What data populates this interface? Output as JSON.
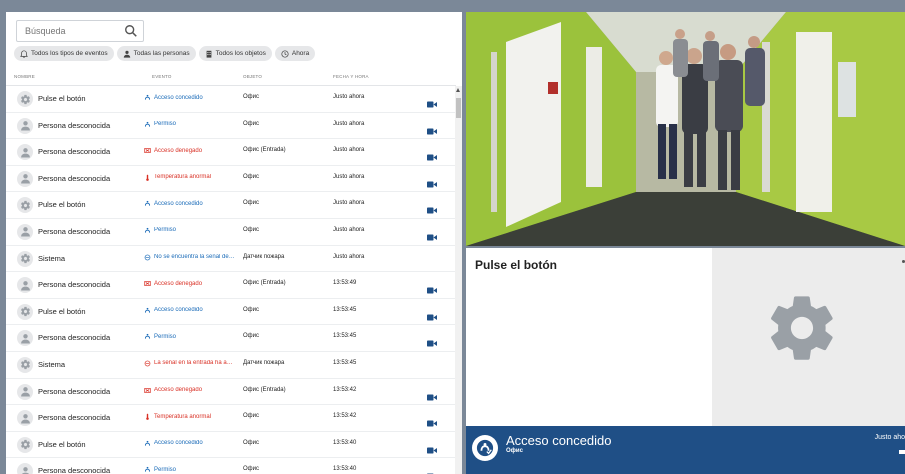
{
  "search": {
    "placeholder": "Búsqueda"
  },
  "filters": [
    {
      "icon": "bell-icon",
      "label": "Todos los tipos de eventos"
    },
    {
      "icon": "person-icon",
      "label": "Todas las personas"
    },
    {
      "icon": "building-icon",
      "label": "Todos los objetos"
    },
    {
      "icon": "clock-icon",
      "label": "Ahora"
    }
  ],
  "columns": {
    "name": "NOMBRE",
    "event": "EVENTO",
    "object": "OBJETO",
    "datetime": "FECHA Y HORA"
  },
  "colors": {
    "accent_blue": "#1f4f86",
    "event_blue": "#1a6bb8",
    "event_red": "#d93025",
    "banner": "#1f4f86"
  },
  "rows": [
    {
      "avatar": "gear-icon",
      "name": "Pulse el botón",
      "event_icon": "access-granted-icon",
      "event": "Acceso concedido",
      "event_color": "blue",
      "object": "Офис",
      "time": "Justo ahora",
      "camera": true
    },
    {
      "avatar": "person-icon",
      "name": "Persona desconocida",
      "event_icon": "access-granted-icon",
      "event": "Permiso",
      "event_color": "blue",
      "object": "Офис",
      "time": "Justo ahora",
      "camera": true
    },
    {
      "avatar": "person-icon",
      "name": "Persona desconocida",
      "event_icon": "access-denied-icon",
      "event": "Acceso denegado",
      "event_color": "red",
      "object": "Офис (Entrada)",
      "time": "Justo ahora",
      "camera": true
    },
    {
      "avatar": "person-icon",
      "name": "Persona desconocida",
      "event_icon": "thermometer-icon",
      "event": "Temperatura anormal",
      "event_color": "red",
      "object": "Офис",
      "time": "Justo ahora",
      "camera": true
    },
    {
      "avatar": "gear-icon",
      "name": "Pulse el botón",
      "event_icon": "access-granted-icon",
      "event": "Acceso concedido",
      "event_color": "blue",
      "object": "Офис",
      "time": "Justo ahora",
      "camera": true
    },
    {
      "avatar": "person-icon",
      "name": "Persona desconocida",
      "event_icon": "access-granted-icon",
      "event": "Permiso",
      "event_color": "blue",
      "object": "Офис",
      "time": "Justo ahora",
      "camera": true
    },
    {
      "avatar": "gear-icon",
      "name": "Sistema",
      "event_icon": "signal-icon",
      "event": "No se encuentra la señal de…",
      "event_color": "blue",
      "object": "Датчик пожара",
      "time": "Justo ahora",
      "camera": false
    },
    {
      "avatar": "person-icon",
      "name": "Persona desconocida",
      "event_icon": "access-denied-icon",
      "event": "Acceso denegado",
      "event_color": "red",
      "object": "Офис (Entrada)",
      "time": "13:53:49",
      "camera": true
    },
    {
      "avatar": "gear-icon",
      "name": "Pulse el botón",
      "event_icon": "access-granted-icon",
      "event": "Acceso concedido",
      "event_color": "blue",
      "object": "Офис",
      "time": "13:53:45",
      "camera": true
    },
    {
      "avatar": "person-icon",
      "name": "Persona desconocida",
      "event_icon": "access-granted-icon",
      "event": "Permiso",
      "event_color": "blue",
      "object": "Офис",
      "time": "13:53:45",
      "camera": true
    },
    {
      "avatar": "gear-icon",
      "name": "Sistema",
      "event_icon": "signal-icon",
      "event": "La señal en la entrada ha a…",
      "event_color": "red",
      "object": "Датчик пожара",
      "time": "13:53:45",
      "camera": false
    },
    {
      "avatar": "person-icon",
      "name": "Persona desconocida",
      "event_icon": "access-denied-icon",
      "event": "Acceso denegado",
      "event_color": "red",
      "object": "Офис (Entrada)",
      "time": "13:53:42",
      "camera": true
    },
    {
      "avatar": "person-icon",
      "name": "Persona desconocida",
      "event_icon": "thermometer-icon",
      "event": "Temperatura anormal",
      "event_color": "red",
      "object": "Офис",
      "time": "13:53:42",
      "camera": true
    },
    {
      "avatar": "gear-icon",
      "name": "Pulse el botón",
      "event_icon": "access-granted-icon",
      "event": "Acceso concedido",
      "event_color": "blue",
      "object": "Офис",
      "time": "13:53:40",
      "camera": true
    },
    {
      "avatar": "person-icon",
      "name": "Persona desconocida",
      "event_icon": "access-granted-icon",
      "event": "Permiso",
      "event_color": "blue",
      "object": "Офис",
      "time": "13:53:40",
      "camera": true
    }
  ],
  "detail": {
    "title": "Pulse el botón",
    "icon": "gear-icon"
  },
  "banner": {
    "title": "Acceso concedido",
    "subtitle": "Офис",
    "time": "Justo aho"
  }
}
